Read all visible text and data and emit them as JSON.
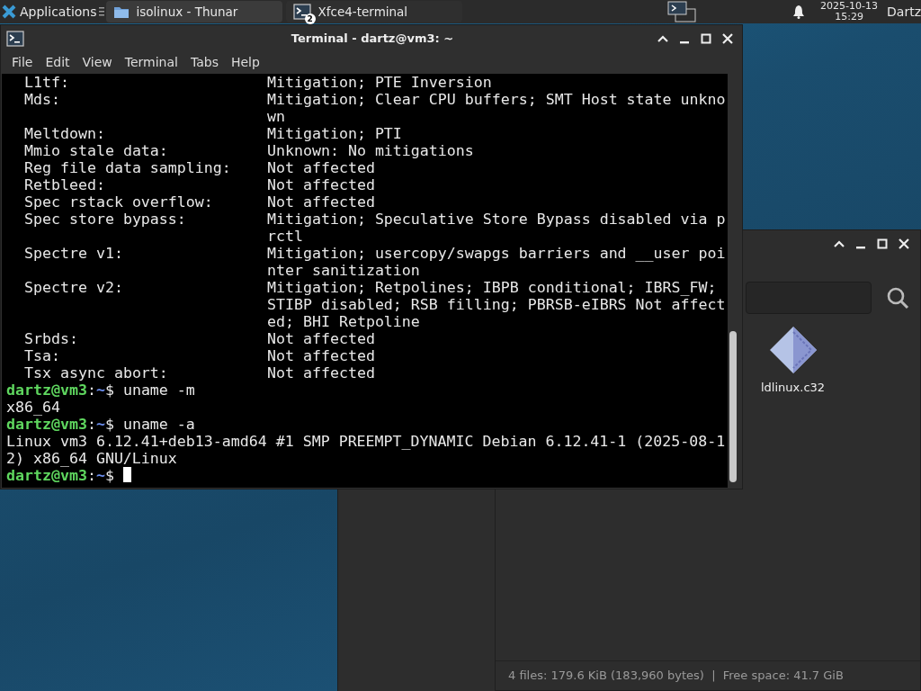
{
  "panel": {
    "apps_label": "Applications",
    "tasks": [
      {
        "kind": "folder",
        "label": "isolinux - Thunar",
        "selected": false
      },
      {
        "kind": "terminal",
        "label": "Xfce4-terminal",
        "selected": true,
        "badge": "2"
      }
    ],
    "clock": {
      "date": "2025-10-13",
      "time": "15:29"
    },
    "user": "Dartz"
  },
  "thunar": {
    "files": [
      {
        "name": "ldlinux.c32"
      }
    ],
    "status_bar": "4 files: 179.6 KiB (183,960 bytes)  |  Free space: 41.7 GiB"
  },
  "terminal": {
    "title": "Terminal - dartz@vm3: ~",
    "menu": [
      "File",
      "Edit",
      "View",
      "Terminal",
      "Tabs",
      "Help"
    ],
    "lines": [
      {
        "kind": "vuln",
        "name": "L1tf:",
        "value": "Mitigation; PTE Inversion"
      },
      {
        "kind": "vuln",
        "name": "Mds:",
        "value": "Mitigation; Clear CPU buffers; SMT Host state unkno"
      },
      {
        "kind": "cont",
        "value": "wn"
      },
      {
        "kind": "vuln",
        "name": "Meltdown:",
        "value": "Mitigation; PTI"
      },
      {
        "kind": "vuln",
        "name": "Mmio stale data:",
        "value": "Unknown: No mitigations"
      },
      {
        "kind": "vuln",
        "name": "Reg file data sampling:",
        "value": "Not affected"
      },
      {
        "kind": "vuln",
        "name": "Retbleed:",
        "value": "Not affected"
      },
      {
        "kind": "vuln",
        "name": "Spec rstack overflow:",
        "value": "Not affected"
      },
      {
        "kind": "vuln",
        "name": "Spec store bypass:",
        "value": "Mitigation; Speculative Store Bypass disabled via p"
      },
      {
        "kind": "cont",
        "value": "rctl"
      },
      {
        "kind": "vuln",
        "name": "Spectre v1:",
        "value": "Mitigation; usercopy/swapgs barriers and __user poi"
      },
      {
        "kind": "cont",
        "value": "nter sanitization"
      },
      {
        "kind": "vuln",
        "name": "Spectre v2:",
        "value": "Mitigation; Retpolines; IBPB conditional; IBRS_FW;"
      },
      {
        "kind": "cont",
        "value": "STIBP disabled; RSB filling; PBRSB-eIBRS Not affect"
      },
      {
        "kind": "cont",
        "value": "ed; BHI Retpoline"
      },
      {
        "kind": "vuln",
        "name": "Srbds:",
        "value": "Not affected"
      },
      {
        "kind": "vuln",
        "name": "Tsa:",
        "value": "Not affected"
      },
      {
        "kind": "vuln",
        "name": "Tsx async abort:",
        "value": "Not affected"
      },
      {
        "kind": "prompt",
        "user": "dartz@vm3",
        "sep": ":",
        "dir": "~",
        "sign": "$",
        "command": "uname -m"
      },
      {
        "kind": "output",
        "text": "x86_64"
      },
      {
        "kind": "prompt",
        "user": "dartz@vm3",
        "sep": ":",
        "dir": "~",
        "sign": "$",
        "command": "uname -a"
      },
      {
        "kind": "output",
        "text": "Linux vm3 6.12.41+deb13-amd64 #1 SMP PREEMPT_DYNAMIC Debian 6.12.41-1 (2025-08-1"
      },
      {
        "kind": "output",
        "text": "2) x86_64 GNU/Linux"
      },
      {
        "kind": "prompt",
        "user": "dartz@vm3",
        "sep": ":",
        "dir": "~",
        "sign": "$",
        "cursor": true
      }
    ]
  }
}
